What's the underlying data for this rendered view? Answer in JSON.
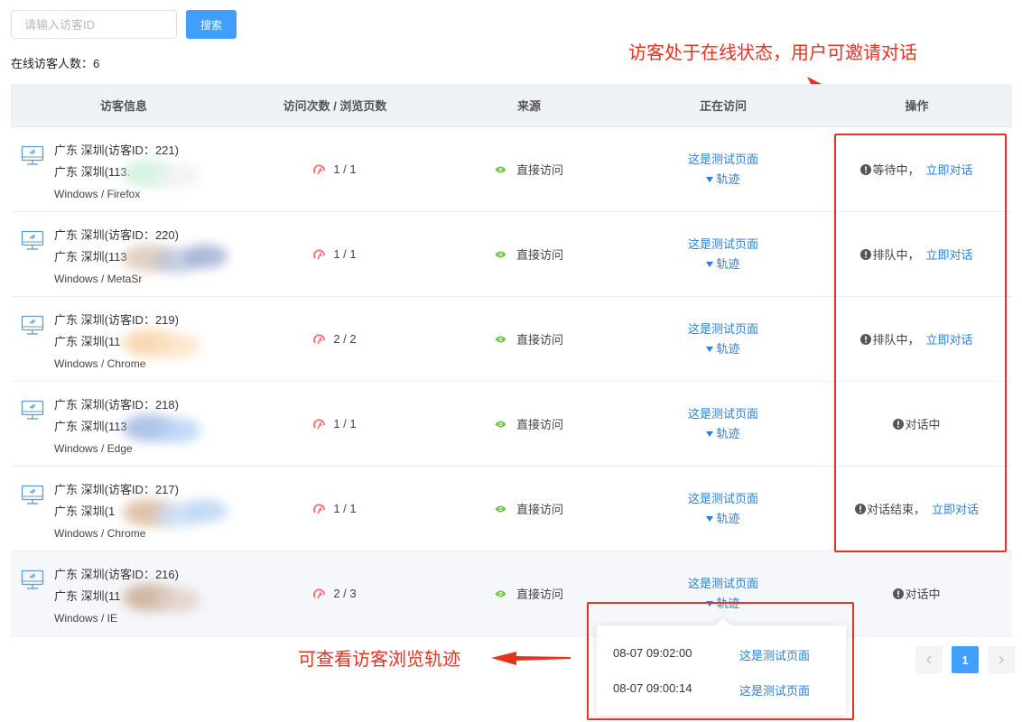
{
  "search": {
    "placeholder": "请输入访客ID",
    "button_label": "搜索"
  },
  "online_count": "在线访客人数：6",
  "table": {
    "headers": [
      "访客信息",
      "访问次数 / 浏览页数",
      "来源",
      "正在访问",
      "操作"
    ],
    "rows": [
      {
        "line1": "广东 深圳(访客ID：221)",
        "line2": "广东 深圳(113.",
        "line3": "Windows / Firefox",
        "visits": "1 / 1",
        "source": "直接访问",
        "page": "这是测试页面",
        "trail": "轨迹",
        "status": "等待中，",
        "action": "立即对话"
      },
      {
        "line1": "广东 深圳(访客ID：220)",
        "line2": "广东 深圳(113",
        "line3": "Windows / MetaSr",
        "visits": "1 / 1",
        "source": "直接访问",
        "page": "这是测试页面",
        "trail": "轨迹",
        "status": "排队中，",
        "action": "立即对话"
      },
      {
        "line1": "广东 深圳(访客ID：219)",
        "line2": "广东 深圳(11",
        "line3": "Windows / Chrome",
        "visits": "2 / 2",
        "source": "直接访问",
        "page": "这是测试页面",
        "trail": "轨迹",
        "status": "排队中，",
        "action": "立即对话"
      },
      {
        "line1": "广东 深圳(访客ID：218)",
        "line2": "广东 深圳(113",
        "line3": "Windows / Edge",
        "visits": "1 / 1",
        "source": "直接访问",
        "page": "这是测试页面",
        "trail": "轨迹",
        "status": "对话中",
        "action": ""
      },
      {
        "line1": "广东 深圳(访客ID：217)",
        "line2": "广东 深圳(1",
        "line3": "Windows / Chrome",
        "visits": "1 / 1",
        "source": "直接访问",
        "page": "这是测试页面",
        "trail": "轨迹",
        "status": "对话结束，",
        "action": "立即对话"
      },
      {
        "line1": "广东 深圳(访客ID：216)",
        "line2": "广东 深圳(11",
        "line3": "Windows / IE",
        "visits": "2 / 3",
        "source": "直接访问",
        "page": "这是测试页面",
        "trail": "轨迹",
        "status": "对话中",
        "action": ""
      }
    ]
  },
  "trail_popup": {
    "items": [
      {
        "time": "08-07 09:02:00",
        "page": "这是测试页面"
      },
      {
        "time": "08-07 09:00:14",
        "page": "这是测试页面"
      }
    ]
  },
  "pagination": {
    "current": "1"
  },
  "annotations": {
    "top": "访客处于在线状态，用户可邀请对话",
    "bottom": "可查看访客浏览轨迹"
  },
  "colors": {
    "accent": "#409eff",
    "link": "#2b7fd9",
    "annotation": "#e8321f",
    "visit_icon": "#f56c6c",
    "source_icon": "#67c23a"
  }
}
